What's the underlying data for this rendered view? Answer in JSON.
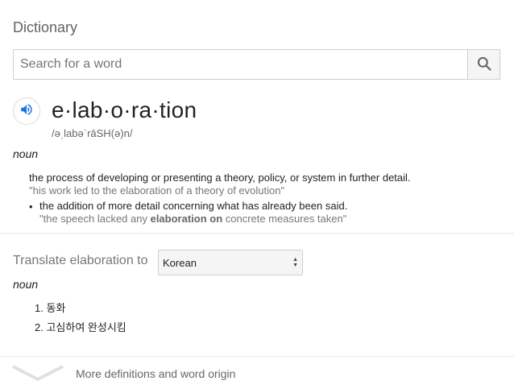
{
  "header": {
    "title": "Dictionary"
  },
  "search": {
    "placeholder": "Search for a word",
    "value": ""
  },
  "entry": {
    "word": "e·lab·o·ra·tion",
    "phonetic": "/əˌlabəˈrāSH(ə)n/",
    "part_of_speech": "noun",
    "definition": "the process of developing or presenting a theory, policy, or system in further detail.",
    "example": "\"his work led to the elaboration of a theory of evolution\"",
    "sub_bullet": "•",
    "sub_definition": "the addition of more detail concerning what has already been said.",
    "sub_example": {
      "prefix": "\"the speech lacked any ",
      "bold": "elaboration on",
      "suffix": " concrete measures taken\""
    }
  },
  "translate": {
    "label": "Translate elaboration to",
    "language": "Korean",
    "part_of_speech": "noun",
    "items": [
      "1. 동화",
      "2. 고심하여 완성시킴"
    ]
  },
  "footer": {
    "more_label": "More definitions and word origin"
  },
  "colors": {
    "accent": "#1a73e8",
    "muted": "#777777",
    "divider": "#e8e8e8"
  }
}
